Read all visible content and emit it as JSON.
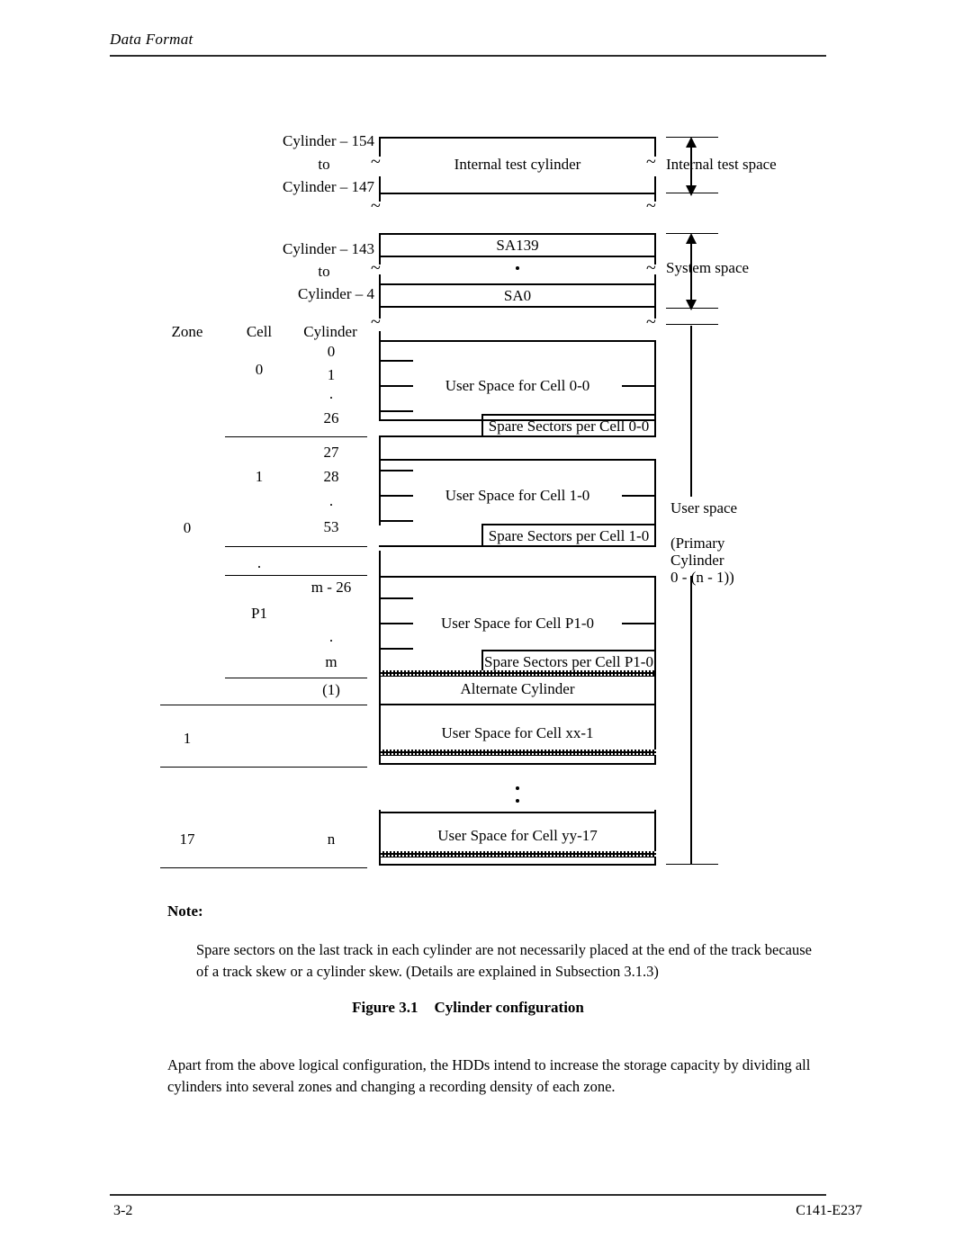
{
  "page": {
    "header_title": "Data Format",
    "footer_page_number": "3-2",
    "footer_document_id": "C141-E237"
  },
  "figure": {
    "caption_number": "Figure 3.1",
    "caption_title": "Cylinder configuration",
    "column_headers": {
      "zone": "Zone",
      "cell": "Cell",
      "cylinder": "Cylinder"
    },
    "internal_test": {
      "cylinder_range_top": "Cylinder – 154",
      "cylinder_range_mid": "to",
      "cylinder_range_bottom": "Cylinder – 147",
      "box_label": "Internal test cylinder",
      "space_label": "Internal test space"
    },
    "system": {
      "cylinder_range_top": "Cylinder – 143",
      "cylinder_range_mid": "to",
      "cylinder_range_bottom": "Cylinder – 4",
      "box_top_label": "SA139",
      "box_bottom_label": "SA0",
      "space_label": "System space"
    },
    "user_space_bracket": {
      "line1": "User space",
      "line2": "(Primary",
      "line3": "Cylinder",
      "line4": "0 - (n - 1))"
    },
    "zones": [
      {
        "zone": "0",
        "cells": [
          {
            "cell": "0",
            "cylinders": [
              "0",
              "1",
              ".",
              "26"
            ],
            "user_space": "User Space for Cell 0-0",
            "spare_sectors": "Spare Sectors per Cell 0-0"
          },
          {
            "cell": "1",
            "cylinders": [
              "27",
              "28",
              ".",
              "53"
            ],
            "user_space": "User Space for Cell 1-0",
            "spare_sectors": "Spare Sectors per Cell 1-0"
          },
          {
            "cell": "P1",
            "cylinders": [
              "m - 26",
              "",
              ".",
              "m"
            ],
            "user_space": "User Space for Cell P1-0",
            "spare_sectors": "Spare Sectors per Cell P1-0"
          }
        ],
        "alternate_cylinder_count": "(1)",
        "alternate_cylinder_label": "Alternate Cylinder"
      },
      {
        "zone": "1",
        "cells": [],
        "user_space": "User Space for Cell xx-1"
      },
      {
        "zone": "17",
        "cells": [],
        "cylinder": "n",
        "user_space": "User Space for Cell yy-17"
      }
    ],
    "zone_gap_ellipsis": ".",
    "cell_gap_ellipsis": ".",
    "sa_gap_ellipsis": "."
  },
  "note": {
    "label": "Note:",
    "text": "Spare sectors on the last track in each cylinder are not necessarily placed at the end of the track because of a track skew or a cylinder skew.  (Details are explained in Subsection 3.1.3)"
  },
  "body": {
    "paragraph": "Apart from the above logical configuration, the HDDs intend to increase the storage capacity by dividing all cylinders into several zones and changing a recording density of each zone."
  }
}
